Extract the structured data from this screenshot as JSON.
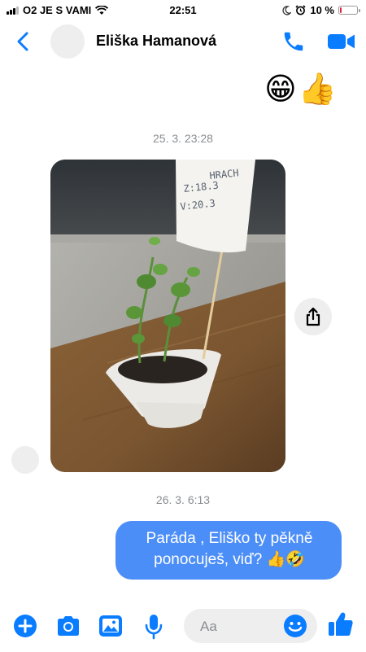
{
  "status_bar": {
    "carrier": "O2 JE S VAMI",
    "time": "22:51",
    "battery_percent": "10 %",
    "battery_level": 0.1
  },
  "header": {
    "contact_name": "Eliška Hamanová",
    "icons": [
      "back-icon",
      "phone-icon",
      "video-camera-icon"
    ]
  },
  "messages": {
    "sent_emoji": "😁👍",
    "timestamp_1": "25. 3. 23:28",
    "timestamp_2": "26. 3. 6:13",
    "photo_label_lines": [
      "HRACH",
      "Z:18.3",
      "V:20.3"
    ],
    "sent_text": "Paráda , Eliško ty pěkně ponocuješ, viď? 👍🤣"
  },
  "composer": {
    "placeholder": "Aa",
    "icons": [
      "plus-icon",
      "camera-icon",
      "image-icon",
      "microphone-icon",
      "emoji-icon",
      "thumbs-up-icon"
    ]
  },
  "colors": {
    "accent": "#0a7cff",
    "bubble": "#4c8ef7",
    "timestamp": "#8a8d91",
    "gray_surface": "#eeeeef"
  }
}
